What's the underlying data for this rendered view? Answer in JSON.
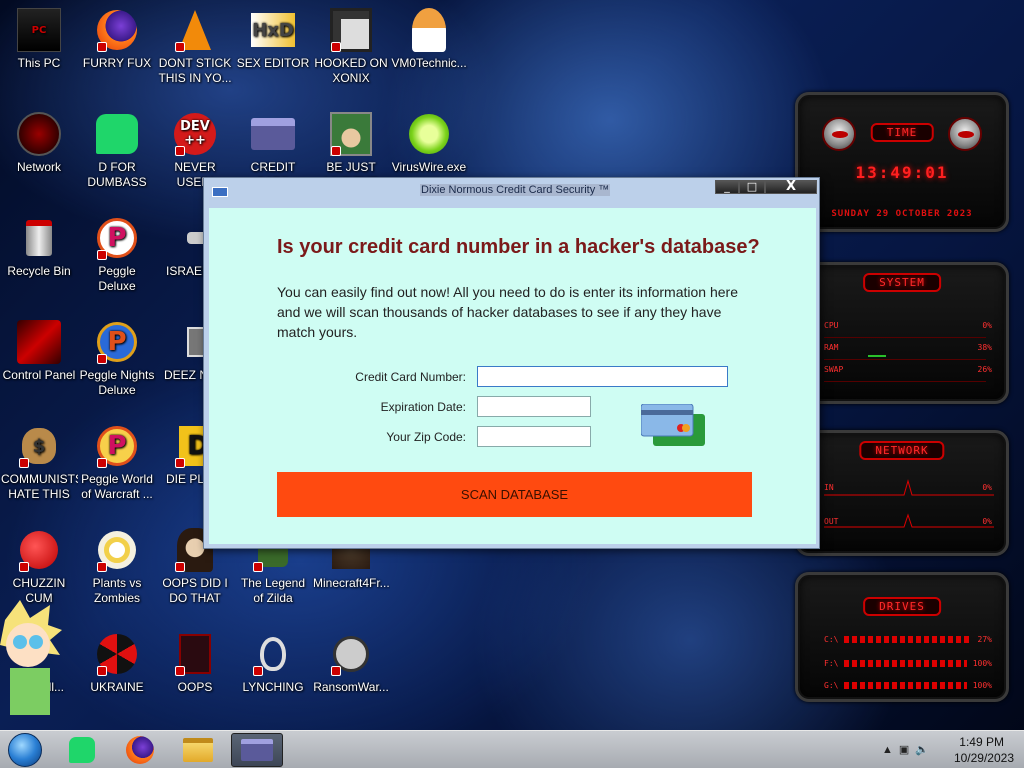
{
  "desktop": {
    "icons": [
      {
        "label": "This PC"
      },
      {
        "label": "FURRY FUX"
      },
      {
        "label": "DONT STICK THIS IN YO..."
      },
      {
        "label": "SEX EDITOR"
      },
      {
        "label": "HOOKED ON XONIX"
      },
      {
        "label": "VM0Technic..."
      },
      {
        "label": "Network"
      },
      {
        "label": "D FOR DUMBASS"
      },
      {
        "label": "NEVER USED!"
      },
      {
        "label": "CREDIT CARD CHECKER"
      },
      {
        "label": "BE JUST LIKE THE DUDE!"
      },
      {
        "label": "VirusWire.exe"
      },
      {
        "label": "Recycle Bin"
      },
      {
        "label": "Peggle Deluxe"
      },
      {
        "label": "ISRAELS"
      },
      {
        "label": "Control Panel"
      },
      {
        "label": "Peggle Nights Deluxe"
      },
      {
        "label": "DEEZ NU"
      },
      {
        "label": "COMMUNISTS HATE THIS G..."
      },
      {
        "label": "Peggle World of Warcraft ..."
      },
      {
        "label": "DIE PLEA"
      },
      {
        "label": "CHUZZIN CUM"
      },
      {
        "label": "Plants vs Zombies"
      },
      {
        "label": "OOPS DID I DO THAT"
      },
      {
        "label": "The Legend of Zilda"
      },
      {
        "label": "Minecraft4Fr..."
      },
      {
        "label": "ad All..."
      },
      {
        "label": "UKRAINE"
      },
      {
        "label": "OOPS"
      },
      {
        "label": "LYNCHING"
      },
      {
        "label": "RansomWar..."
      }
    ],
    "icon_text": {
      "dev": "DEV",
      "dev_sub": "++"
    }
  },
  "gadget": {
    "time_title": "TIME",
    "time": "13:49:01",
    "date": "SUNDAY 29 OCTOBER 2023",
    "system_title": "SYSTEM",
    "cpu_label": "CPU",
    "cpu_value": "0%",
    "ram_label": "RAM",
    "ram_value": "38%",
    "swap_label": "SWAP",
    "swap_value": "26%",
    "network_title": "NETWORK",
    "in_label": "IN",
    "in_value": "0%",
    "out_label": "OUT",
    "out_value": "0%",
    "drives_title": "DRIVES",
    "drives": [
      {
        "label": "C:\\",
        "value": "27%"
      },
      {
        "label": "F:\\",
        "value": "100%"
      },
      {
        "label": "G:\\",
        "value": "100%"
      }
    ]
  },
  "dialog": {
    "title": "Dixie Normous Credit Card Security ™",
    "min": "_",
    "max": "□",
    "close": "X",
    "headline": "Is your credit card number in a hacker's database?",
    "description": "You can easily find out now! All you need to do is enter its information here and we will scan thousands of hacker databases to see if any they have match yours.",
    "card_label": "Credit Card Number:",
    "card_value": "",
    "exp_label": "Expiration Date:",
    "exp_value": "",
    "zip_label": "Your Zip Code:",
    "zip_value": "",
    "scan_label": "SCAN DATABASE"
  },
  "taskbar": {
    "time": "1:49 PM",
    "date": "10/29/2023"
  }
}
